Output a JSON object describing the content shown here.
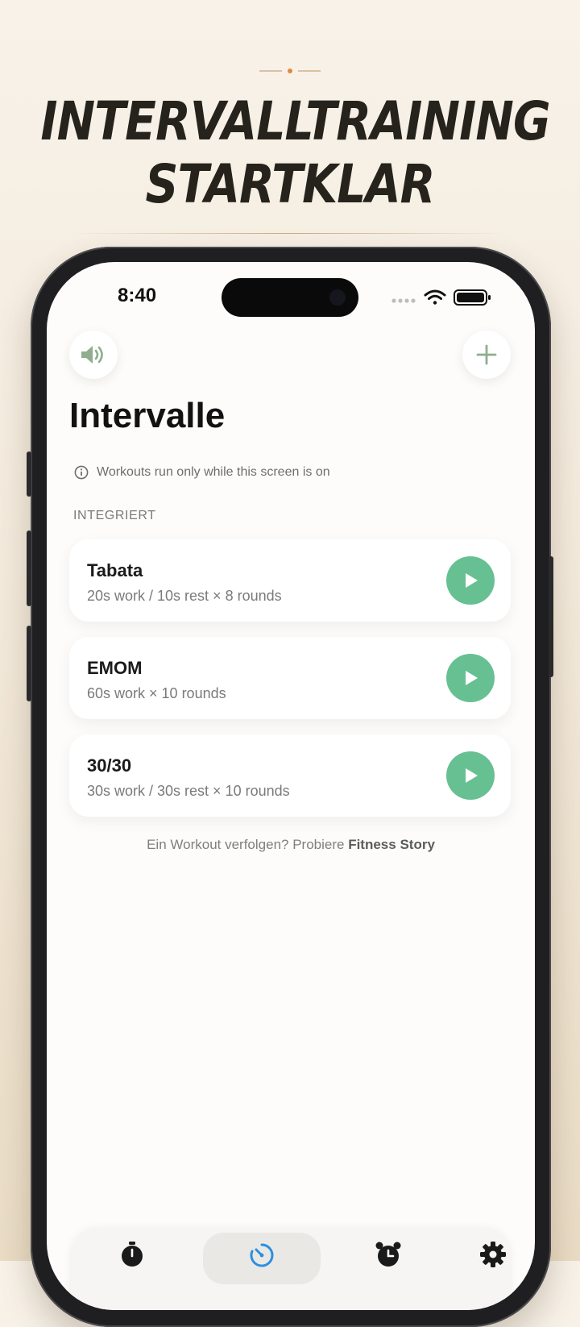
{
  "promo": {
    "headline_line1": "INTERVALLTRAINING",
    "headline_line2": "STARTKLAR"
  },
  "status_bar": {
    "time": "8:40"
  },
  "header": {
    "sound_icon": "speaker-icon",
    "add_icon": "plus-icon",
    "title": "Intervalle"
  },
  "info": {
    "icon": "info-icon",
    "text": "Workouts run only while this screen is on"
  },
  "section": {
    "label": "INTEGRIERT"
  },
  "workouts": [
    {
      "name": "Tabata",
      "description": "20s work / 10s rest × 8 rounds"
    },
    {
      "name": "EMOM",
      "description": "60s work × 10 rounds"
    },
    {
      "name": "30/30",
      "description": "30s work / 30s rest × 10 rounds"
    }
  ],
  "footer": {
    "prefix": "Ein Workout verfolgen? Probiere ",
    "link": "Fitness Story"
  },
  "tabs": [
    {
      "icon": "stopwatch-icon",
      "active": false
    },
    {
      "icon": "interval-timer-icon",
      "active": true
    },
    {
      "icon": "alarm-clock-icon",
      "active": false
    },
    {
      "icon": "gear-icon",
      "active": false
    }
  ],
  "colors": {
    "accent_green": "#67c091",
    "active_tab_blue": "#2b8fe0",
    "icon_green": "#8fae8e"
  }
}
